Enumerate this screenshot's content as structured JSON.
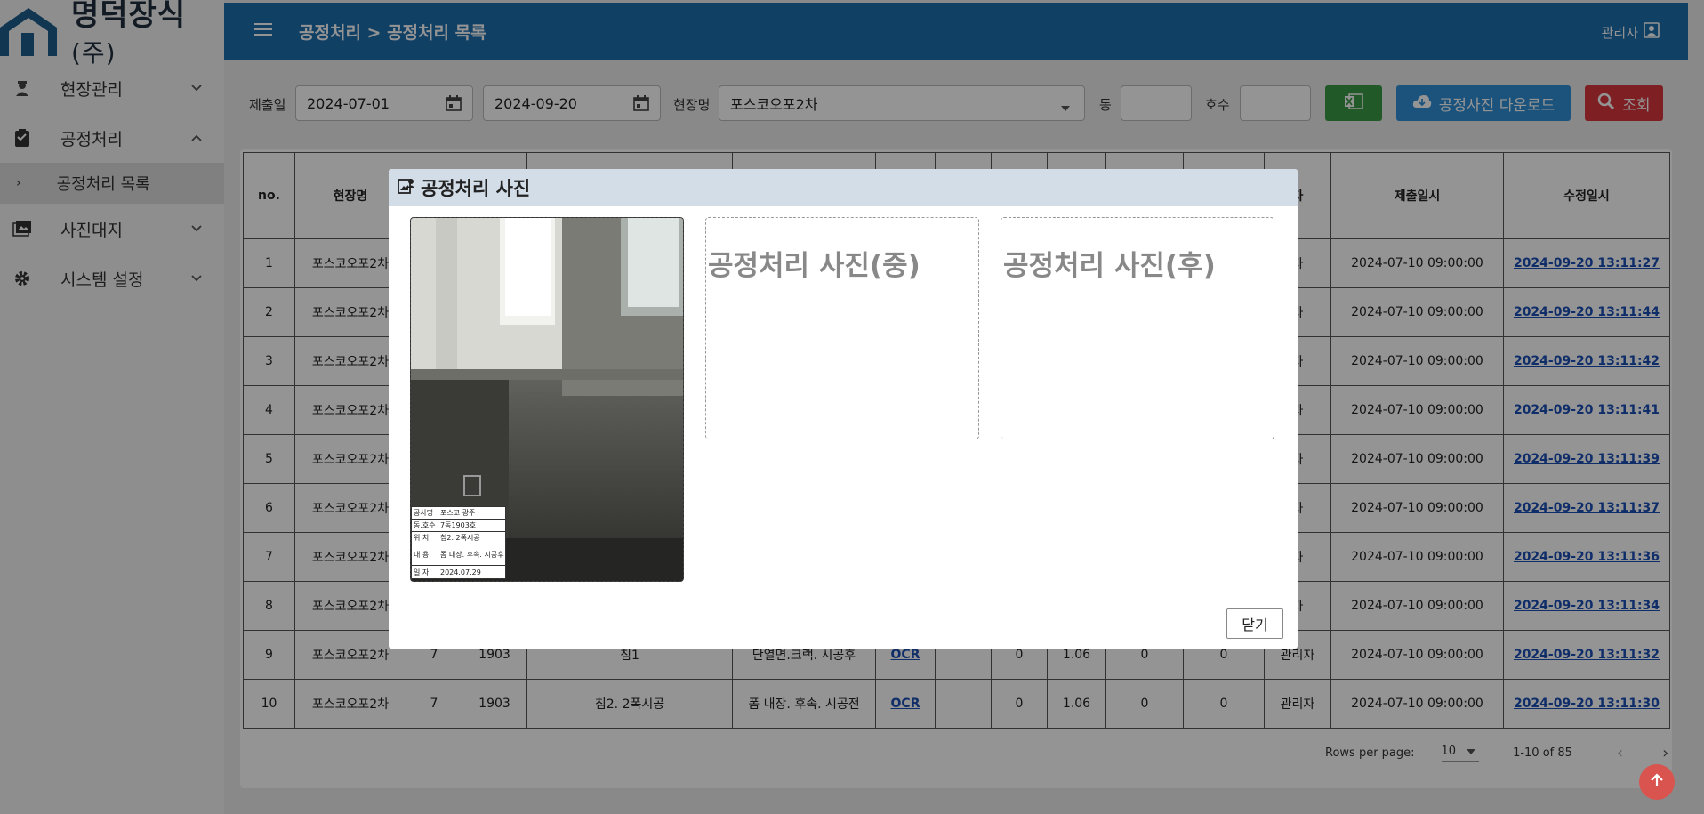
{
  "brand": {
    "name": "명덕장식",
    "suffix": "(주)"
  },
  "sidebar": {
    "items": [
      {
        "label": "현장관리",
        "icon": "worker-icon"
      },
      {
        "label": "공정처리",
        "icon": "clipboard-icon",
        "expanded": true
      },
      {
        "label": "사진대지",
        "icon": "photo-album-icon"
      },
      {
        "label": "시스템 설정",
        "icon": "gear-icon"
      }
    ],
    "sub_items": [
      {
        "label": "공정처리 목록"
      }
    ]
  },
  "header": {
    "breadcrumb": "공정처리 > 공정처리 목록",
    "user": "관리자"
  },
  "filters": {
    "submit_label": "제출일",
    "date_from": "2024-07-01",
    "date_to": "2024-09-20",
    "site_label": "현장명",
    "site_value": "포스코오포2차",
    "dong_label": "동",
    "dong_value": "",
    "ho_label": "호수",
    "ho_value": "",
    "download_label": "공정사진 다운로드",
    "search_label": "조회"
  },
  "table": {
    "headers": [
      "no.",
      "현장명",
      "",
      "",
      "",
      "",
      "",
      "",
      "",
      "",
      "",
      "",
      "자",
      "제출일시",
      "수정일시"
    ],
    "rows": [
      {
        "no": "1",
        "site": "포스코오포2차",
        "dong": "",
        "ho": "",
        "loc": "",
        "content": "",
        "ocr": "",
        "v1": "",
        "v2": "",
        "v3": "",
        "v4": "",
        "user": "자",
        "submitted": "2024-07-10 09:00:00",
        "modified": "2024-09-20 13:11:27"
      },
      {
        "no": "2",
        "site": "포스코오포2차",
        "dong": "",
        "ho": "",
        "loc": "",
        "content": "",
        "ocr": "",
        "v1": "",
        "v2": "",
        "v3": "",
        "v4": "",
        "user": "자",
        "submitted": "2024-07-10 09:00:00",
        "modified": "2024-09-20 13:11:44"
      },
      {
        "no": "3",
        "site": "포스코오포2차",
        "dong": "",
        "ho": "",
        "loc": "",
        "content": "",
        "ocr": "",
        "v1": "",
        "v2": "",
        "v3": "",
        "v4": "",
        "user": "자",
        "submitted": "2024-07-10 09:00:00",
        "modified": "2024-09-20 13:11:42"
      },
      {
        "no": "4",
        "site": "포스코오포2차",
        "dong": "",
        "ho": "",
        "loc": "",
        "content": "",
        "ocr": "",
        "v1": "",
        "v2": "",
        "v3": "",
        "v4": "",
        "user": "자",
        "submitted": "2024-07-10 09:00:00",
        "modified": "2024-09-20 13:11:41"
      },
      {
        "no": "5",
        "site": "포스코오포2차",
        "dong": "",
        "ho": "",
        "loc": "",
        "content": "",
        "ocr": "",
        "v1": "",
        "v2": "",
        "v3": "",
        "v4": "",
        "user": "자",
        "submitted": "2024-07-10 09:00:00",
        "modified": "2024-09-20 13:11:39"
      },
      {
        "no": "6",
        "site": "포스코오포2차",
        "dong": "",
        "ho": "",
        "loc": "",
        "content": "",
        "ocr": "",
        "v1": "",
        "v2": "",
        "v3": "",
        "v4": "",
        "user": "자",
        "submitted": "2024-07-10 09:00:00",
        "modified": "2024-09-20 13:11:37"
      },
      {
        "no": "7",
        "site": "포스코오포2차",
        "dong": "",
        "ho": "",
        "loc": "",
        "content": "",
        "ocr": "",
        "v1": "",
        "v2": "",
        "v3": "",
        "v4": "",
        "user": "자",
        "submitted": "2024-07-10 09:00:00",
        "modified": "2024-09-20 13:11:36"
      },
      {
        "no": "8",
        "site": "포스코오포2차",
        "dong": "",
        "ho": "",
        "loc": "",
        "content": "",
        "ocr": "",
        "v1": "",
        "v2": "",
        "v3": "",
        "v4": "",
        "user": "자",
        "submitted": "2024-07-10 09:00:00",
        "modified": "2024-09-20 13:11:34"
      },
      {
        "no": "9",
        "site": "포스코오포2차",
        "dong": "7",
        "ho": "1903",
        "loc": "침1",
        "content": "단열면.크랙. 시공후",
        "ocr": "OCR",
        "v1": "0",
        "v2": "1.06",
        "v3": "0",
        "v4": "0",
        "user": "관리자",
        "submitted": "2024-07-10 09:00:00",
        "modified": "2024-09-20 13:11:32"
      },
      {
        "no": "10",
        "site": "포스코오포2차",
        "dong": "7",
        "ho": "1903",
        "loc": "침2. 2폭시공",
        "content": "폼 내장. 후속. 시공전",
        "ocr": "OCR",
        "v1": "0",
        "v2": "1.06",
        "v3": "0",
        "v4": "0",
        "user": "관리자",
        "submitted": "2024-07-10 09:00:00",
        "modified": "2024-09-20 13:11:30"
      }
    ]
  },
  "pager": {
    "rows_label": "Rows per page:",
    "rows_value": "10",
    "range": "1-10 of 85"
  },
  "modal": {
    "title": "공정처리 사진",
    "photo_mid": "공정처리 사진(중)",
    "photo_after": "공정처리 사진(후)",
    "close_label": "닫기",
    "memo": [
      {
        "k": "공사명",
        "v": "포스코 광주"
      },
      {
        "k": "동.호수",
        "v": "7동1903호"
      },
      {
        "k": "위 치",
        "v": "침2.   2폭시공"
      },
      {
        "k": "내 용",
        "v": "폼 내장. 후속.  시공후"
      },
      {
        "k": "일 자",
        "v": "2024.07.29"
      }
    ]
  },
  "colors": {
    "header": "#1e6fae",
    "excel": "#3b9a45",
    "download": "#2f8fd8",
    "search": "#d9363e"
  }
}
